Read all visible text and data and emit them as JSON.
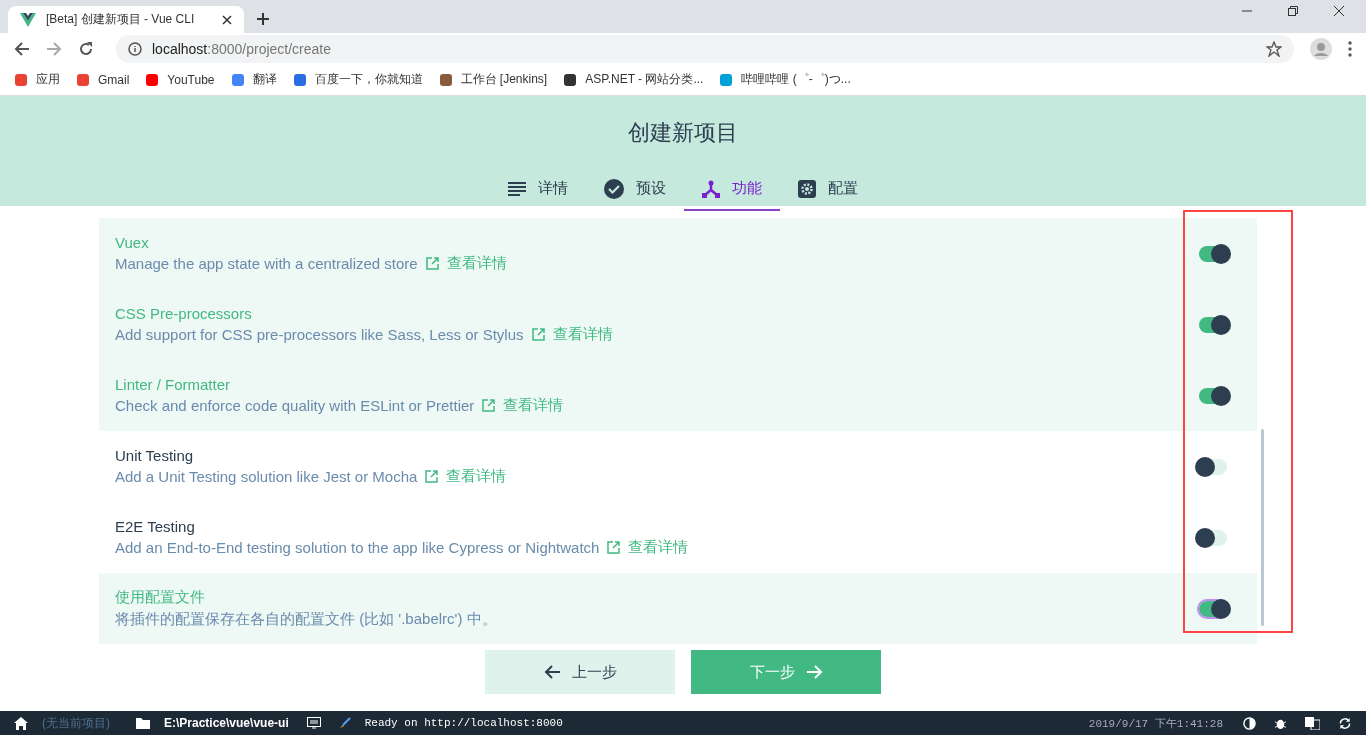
{
  "browser": {
    "tab_title": "[Beta] 创建新项目 - Vue CLI",
    "url_host": "localhost",
    "url_rest": ":8000/project/create",
    "bookmarks": [
      {
        "label": "应用"
      },
      {
        "label": "Gmail"
      },
      {
        "label": "YouTube"
      },
      {
        "label": "翻译"
      },
      {
        "label": "百度一下，你就知道"
      },
      {
        "label": "工作台 [Jenkins]"
      },
      {
        "label": "ASP.NET - 网站分类..."
      },
      {
        "label": "哔哩哔哩 (゜-゜)つ..."
      }
    ]
  },
  "page": {
    "title": "创建新项目",
    "tabs": [
      {
        "label": "详情",
        "selected": false
      },
      {
        "label": "预设",
        "selected": false
      },
      {
        "label": "功能",
        "selected": true
      },
      {
        "label": "配置",
        "selected": false
      }
    ],
    "features": [
      {
        "name": "Vuex",
        "description": "Manage the app state with a centralized store",
        "link": "查看详情",
        "enabled": true,
        "focused": false
      },
      {
        "name": "CSS Pre-processors",
        "description": "Add support for CSS pre-processors like Sass, Less or Stylus",
        "link": "查看详情",
        "enabled": true,
        "focused": false
      },
      {
        "name": "Linter / Formatter",
        "description": "Check and enforce code quality with ESLint or Prettier",
        "link": "查看详情",
        "enabled": true,
        "focused": false
      },
      {
        "name": "Unit Testing",
        "description": "Add a Unit Testing solution like Jest or Mocha",
        "link": "查看详情",
        "enabled": false,
        "focused": false
      },
      {
        "name": "E2E Testing",
        "description": "Add an End-to-End testing solution to the app like Cypress or Nightwatch",
        "link": "查看详情",
        "enabled": false,
        "focused": false
      },
      {
        "name": "使用配置文件",
        "description": "将插件的配置保存在各自的配置文件 (比如 '.babelrc') 中。",
        "enabled": true,
        "focused": true
      }
    ],
    "buttons": {
      "previous": "上一步",
      "next": "下一步"
    }
  },
  "status_bar": {
    "project": "(无当前项目)",
    "path": "E:\\Practice\\vue\\vue-ui",
    "log": "Ready on http://localhost:8000",
    "datetime": "2019/9/17 下午1:41:28"
  }
}
